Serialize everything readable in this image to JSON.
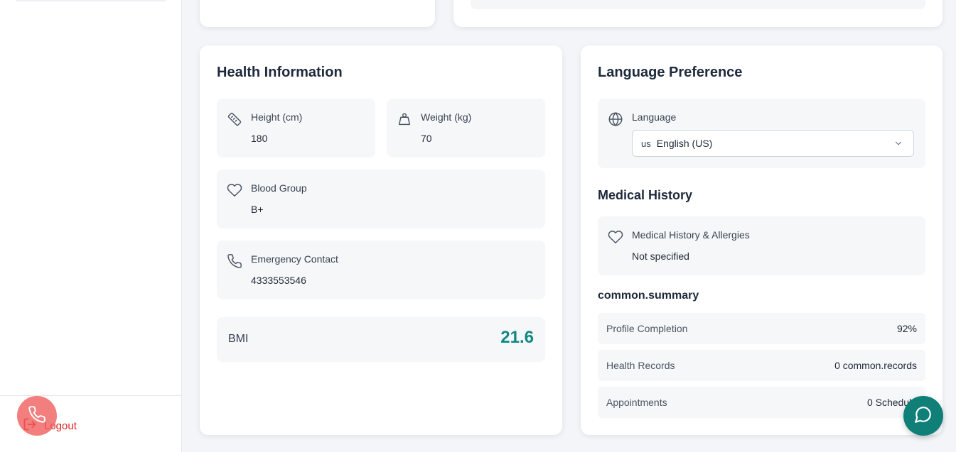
{
  "sidebar": {
    "logout_label": "Logout"
  },
  "health": {
    "title": "Health Information",
    "height": {
      "label": "Height (cm)",
      "value": "180",
      "icon": "ruler-icon"
    },
    "weight": {
      "label": "Weight (kg)",
      "value": "70",
      "icon": "weight-icon"
    },
    "blood_group": {
      "label": "Blood Group",
      "value": "B+",
      "icon": "heart-icon"
    },
    "emergency_contact": {
      "label": "Emergency Contact",
      "value": "4333553546",
      "icon": "phone-icon"
    },
    "bmi": {
      "label": "BMI",
      "value": "21.6"
    }
  },
  "language": {
    "title": "Language Preference",
    "label": "Language",
    "flag": "us",
    "selected": "English (US)"
  },
  "medical_history": {
    "title": "Medical History",
    "label": "Medical History & Allergies",
    "value": "Not specified"
  },
  "summary": {
    "title": "common.summary",
    "rows": [
      {
        "label": "Profile Completion",
        "value": "92%"
      },
      {
        "label": "Health Records",
        "value": "0 common.records"
      },
      {
        "label": "Appointments",
        "value": "0 Schedule"
      }
    ]
  },
  "colors": {
    "accent": "#0f8a80",
    "logout": "#dc2626",
    "call_button": "#ef5a5a",
    "chat_button": "#0f7f78"
  }
}
